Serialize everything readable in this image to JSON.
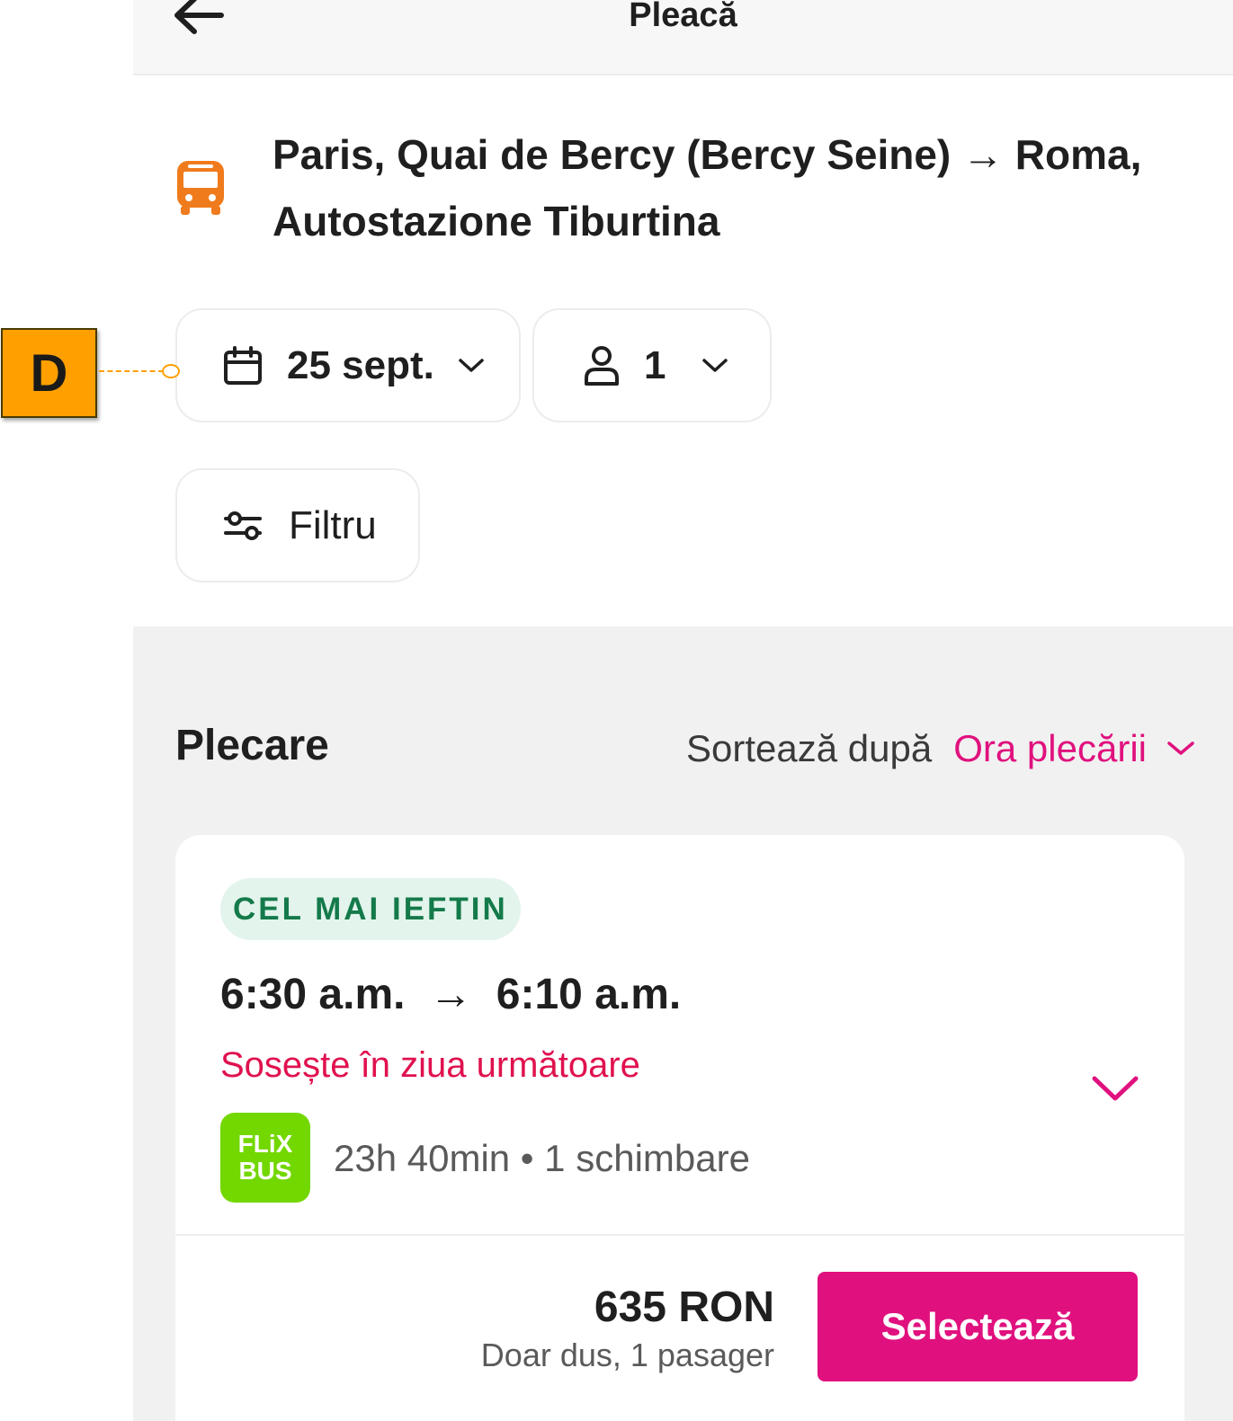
{
  "header": {
    "title": "Pleacă",
    "back_icon": "arrow-left-icon"
  },
  "route": {
    "icon": "bus-icon",
    "text": "Paris, Quai de Bercy (Bercy Seine) → Roma, Autostazione Tiburtina",
    "icon_color": "#f07b1c"
  },
  "search": {
    "date_label": "25 sept.",
    "passengers_label": "1",
    "filter_label": "Filtru"
  },
  "results": {
    "heading": "Plecare",
    "sort_label": "Sortează după",
    "sort_value": "Ora plecării",
    "accent_color": "#e0117e"
  },
  "trip": {
    "badge": "CEL MAI IEFTIN",
    "times": "6:30 a.m.  →  6:10 a.m.",
    "next_day_note": "Sosește în ziua următoare",
    "operator_logo_text_1": "FLiX",
    "operator_logo_text_2": "BUS",
    "duration": "23h 40min • 1 schimbare",
    "price": "635 RON",
    "price_note": "Doar dus, 1 pasager",
    "select_label": "Selectează"
  },
  "annotation": {
    "marker_label": "D"
  }
}
